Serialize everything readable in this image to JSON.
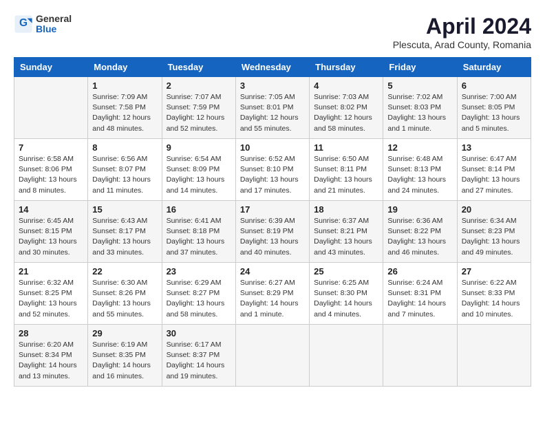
{
  "header": {
    "logo_general": "General",
    "logo_blue": "Blue",
    "month": "April 2024",
    "location": "Plescuta, Arad County, Romania"
  },
  "weekdays": [
    "Sunday",
    "Monday",
    "Tuesday",
    "Wednesday",
    "Thursday",
    "Friday",
    "Saturday"
  ],
  "weeks": [
    [
      {
        "day": "",
        "info": ""
      },
      {
        "day": "1",
        "info": "Sunrise: 7:09 AM\nSunset: 7:58 PM\nDaylight: 12 hours\nand 48 minutes."
      },
      {
        "day": "2",
        "info": "Sunrise: 7:07 AM\nSunset: 7:59 PM\nDaylight: 12 hours\nand 52 minutes."
      },
      {
        "day": "3",
        "info": "Sunrise: 7:05 AM\nSunset: 8:01 PM\nDaylight: 12 hours\nand 55 minutes."
      },
      {
        "day": "4",
        "info": "Sunrise: 7:03 AM\nSunset: 8:02 PM\nDaylight: 12 hours\nand 58 minutes."
      },
      {
        "day": "5",
        "info": "Sunrise: 7:02 AM\nSunset: 8:03 PM\nDaylight: 13 hours\nand 1 minute."
      },
      {
        "day": "6",
        "info": "Sunrise: 7:00 AM\nSunset: 8:05 PM\nDaylight: 13 hours\nand 5 minutes."
      }
    ],
    [
      {
        "day": "7",
        "info": "Sunrise: 6:58 AM\nSunset: 8:06 PM\nDaylight: 13 hours\nand 8 minutes."
      },
      {
        "day": "8",
        "info": "Sunrise: 6:56 AM\nSunset: 8:07 PM\nDaylight: 13 hours\nand 11 minutes."
      },
      {
        "day": "9",
        "info": "Sunrise: 6:54 AM\nSunset: 8:09 PM\nDaylight: 13 hours\nand 14 minutes."
      },
      {
        "day": "10",
        "info": "Sunrise: 6:52 AM\nSunset: 8:10 PM\nDaylight: 13 hours\nand 17 minutes."
      },
      {
        "day": "11",
        "info": "Sunrise: 6:50 AM\nSunset: 8:11 PM\nDaylight: 13 hours\nand 21 minutes."
      },
      {
        "day": "12",
        "info": "Sunrise: 6:48 AM\nSunset: 8:13 PM\nDaylight: 13 hours\nand 24 minutes."
      },
      {
        "day": "13",
        "info": "Sunrise: 6:47 AM\nSunset: 8:14 PM\nDaylight: 13 hours\nand 27 minutes."
      }
    ],
    [
      {
        "day": "14",
        "info": "Sunrise: 6:45 AM\nSunset: 8:15 PM\nDaylight: 13 hours\nand 30 minutes."
      },
      {
        "day": "15",
        "info": "Sunrise: 6:43 AM\nSunset: 8:17 PM\nDaylight: 13 hours\nand 33 minutes."
      },
      {
        "day": "16",
        "info": "Sunrise: 6:41 AM\nSunset: 8:18 PM\nDaylight: 13 hours\nand 37 minutes."
      },
      {
        "day": "17",
        "info": "Sunrise: 6:39 AM\nSunset: 8:19 PM\nDaylight: 13 hours\nand 40 minutes."
      },
      {
        "day": "18",
        "info": "Sunrise: 6:37 AM\nSunset: 8:21 PM\nDaylight: 13 hours\nand 43 minutes."
      },
      {
        "day": "19",
        "info": "Sunrise: 6:36 AM\nSunset: 8:22 PM\nDaylight: 13 hours\nand 46 minutes."
      },
      {
        "day": "20",
        "info": "Sunrise: 6:34 AM\nSunset: 8:23 PM\nDaylight: 13 hours\nand 49 minutes."
      }
    ],
    [
      {
        "day": "21",
        "info": "Sunrise: 6:32 AM\nSunset: 8:25 PM\nDaylight: 13 hours\nand 52 minutes."
      },
      {
        "day": "22",
        "info": "Sunrise: 6:30 AM\nSunset: 8:26 PM\nDaylight: 13 hours\nand 55 minutes."
      },
      {
        "day": "23",
        "info": "Sunrise: 6:29 AM\nSunset: 8:27 PM\nDaylight: 13 hours\nand 58 minutes."
      },
      {
        "day": "24",
        "info": "Sunrise: 6:27 AM\nSunset: 8:29 PM\nDaylight: 14 hours\nand 1 minute."
      },
      {
        "day": "25",
        "info": "Sunrise: 6:25 AM\nSunset: 8:30 PM\nDaylight: 14 hours\nand 4 minutes."
      },
      {
        "day": "26",
        "info": "Sunrise: 6:24 AM\nSunset: 8:31 PM\nDaylight: 14 hours\nand 7 minutes."
      },
      {
        "day": "27",
        "info": "Sunrise: 6:22 AM\nSunset: 8:33 PM\nDaylight: 14 hours\nand 10 minutes."
      }
    ],
    [
      {
        "day": "28",
        "info": "Sunrise: 6:20 AM\nSunset: 8:34 PM\nDaylight: 14 hours\nand 13 minutes."
      },
      {
        "day": "29",
        "info": "Sunrise: 6:19 AM\nSunset: 8:35 PM\nDaylight: 14 hours\nand 16 minutes."
      },
      {
        "day": "30",
        "info": "Sunrise: 6:17 AM\nSunset: 8:37 PM\nDaylight: 14 hours\nand 19 minutes."
      },
      {
        "day": "",
        "info": ""
      },
      {
        "day": "",
        "info": ""
      },
      {
        "day": "",
        "info": ""
      },
      {
        "day": "",
        "info": ""
      }
    ]
  ]
}
